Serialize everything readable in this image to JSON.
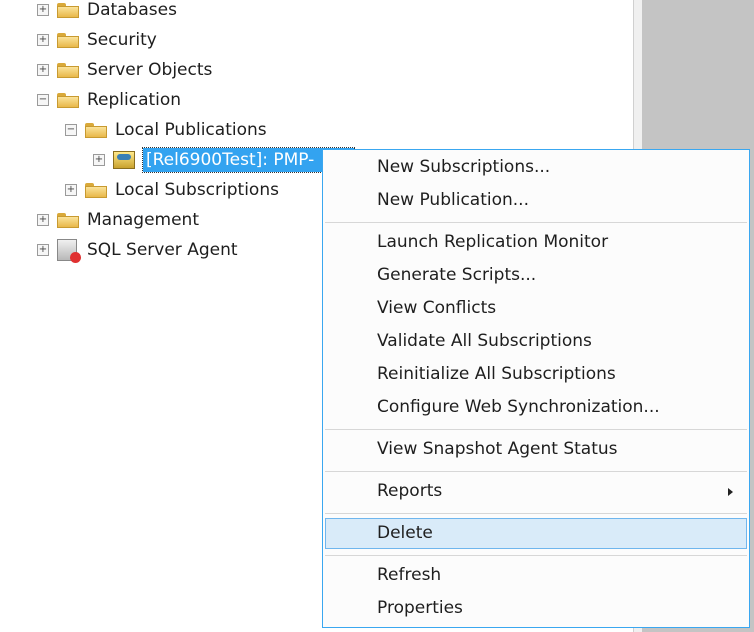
{
  "tree": {
    "databases": "Databases",
    "security": "Security",
    "server_objects": "Server Objects",
    "replication": "Replication",
    "local_publications": "Local Publications",
    "publication": "[Rel6900Test]: PMP-",
    "local_subscriptions": "Local Subscriptions",
    "management": "Management",
    "sql_server_agent": "SQL Server Agent",
    "plus": "+",
    "minus": "−"
  },
  "menu": {
    "items": [
      "New Subscriptions...",
      "New Publication...",
      "Launch Replication Monitor",
      "Generate Scripts...",
      "View Conflicts",
      "Validate All Subscriptions",
      "Reinitialize All Subscriptions",
      "Configure Web Synchronization...",
      "View Snapshot Agent Status",
      "Reports",
      "Delete",
      "Refresh",
      "Properties"
    ],
    "highlighted": "Delete"
  }
}
